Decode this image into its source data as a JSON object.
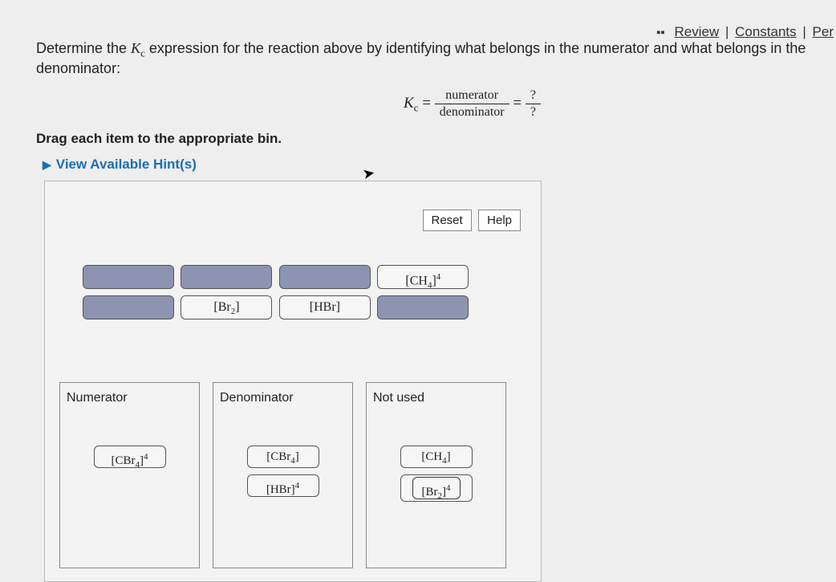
{
  "toplinks": {
    "review": "Review",
    "constants": "Constants",
    "periodic": "Per"
  },
  "question": {
    "prefix": "Determine the ",
    "kc": "K",
    "ksub": "c",
    "suffix": " expression for the reaction above by identifying what belongs in the numerator and what belongs in the denominator:"
  },
  "equation": {
    "lhs_k": "K",
    "lhs_sub": "c",
    "eq": " = ",
    "num1": "numerator",
    "den1": "denominator",
    "num2": "?",
    "den2": "?"
  },
  "instruction": "Drag each item to the appropriate bin.",
  "hints_label": "View Available Hint(s)",
  "buttons": {
    "reset": "Reset",
    "help": "Help"
  },
  "source_items": {
    "row1_slot4_label": "[CH₄]⁴",
    "row2_slot2_label": "[Br₂]",
    "row2_slot3_label": "[HBr]"
  },
  "bins": {
    "numerator": {
      "title": "Numerator",
      "item1": "[CBr₄]⁴"
    },
    "denominator": {
      "title": "Denominator",
      "item1": "[CBr₄]",
      "item2": "[HBr]⁴"
    },
    "notused": {
      "title": "Not used",
      "item1": "[CH₄]",
      "item2": "[Br₂]⁴"
    }
  }
}
